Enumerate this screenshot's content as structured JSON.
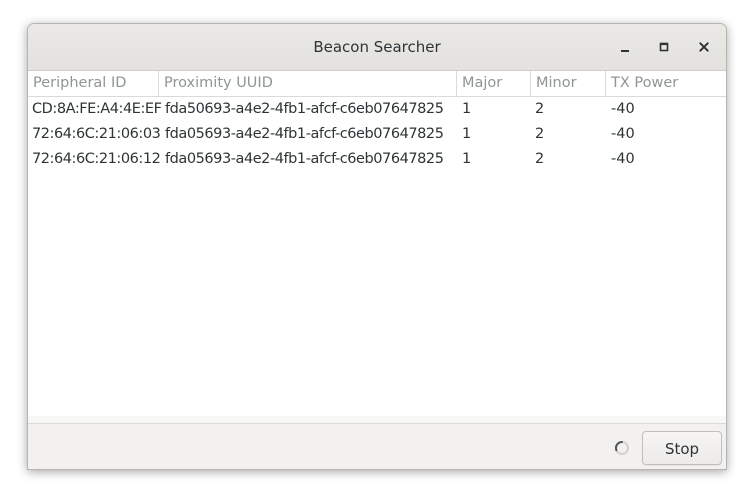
{
  "window": {
    "title": "Beacon Searcher",
    "controls": {
      "minimize_icon": "minimize-icon",
      "maximize_icon": "maximize-icon",
      "close_icon": "close-icon"
    }
  },
  "table": {
    "columns": [
      "Peripheral ID",
      "Proximity UUID",
      "Major",
      "Minor",
      "TX Power"
    ],
    "rows": [
      [
        "CD:8A:FE:A4:4E:EF",
        "fda50693-a4e2-4fb1-afcf-c6eb07647825",
        "1",
        "2",
        "-40"
      ],
      [
        "72:64:6C:21:06:03",
        "fda05693-a4e2-4fb1-afcf-c6eb07647825",
        "1",
        "2",
        "-40"
      ],
      [
        "72:64:6C:21:06:12",
        "fda05693-a4e2-4fb1-afcf-c6eb07647825",
        "1",
        "2",
        "-40"
      ]
    ]
  },
  "footer": {
    "spinner_icon": "spinner-icon",
    "stop_label": "Stop"
  },
  "colors": {
    "text": "#2e3436",
    "header_text": "#8f9596",
    "titlebar": "#e8e6e3",
    "footer": "#f2f1f0"
  }
}
